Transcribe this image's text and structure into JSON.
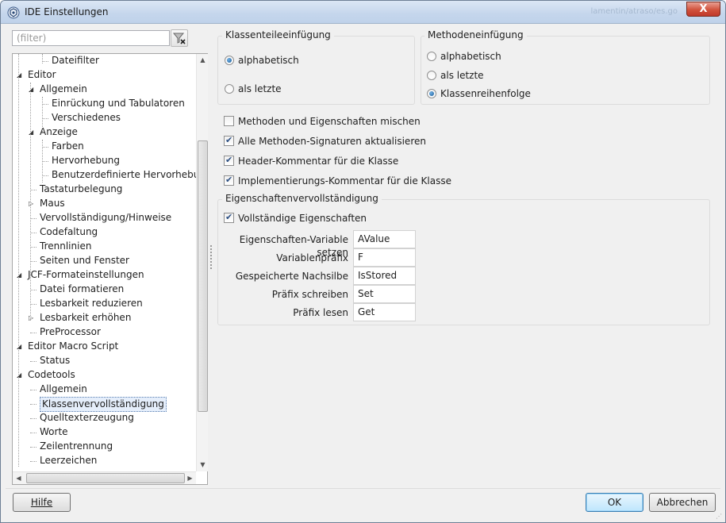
{
  "window": {
    "title": "IDE Einstellungen",
    "close_glyph": "X",
    "ghost_title": "lamentin/atraso/es.go"
  },
  "filter": {
    "placeholder": "(filter)"
  },
  "tree": {
    "items": [
      {
        "label": "Dateifilter",
        "level": 2
      },
      {
        "label": "Editor",
        "level": 0,
        "expanded": true
      },
      {
        "label": "Allgemein",
        "level": 1,
        "expanded": true
      },
      {
        "label": "Einrückung und Tabulatoren",
        "level": 2
      },
      {
        "label": "Verschiedenes",
        "level": 2
      },
      {
        "label": "Anzeige",
        "level": 1,
        "expanded": true
      },
      {
        "label": "Farben",
        "level": 2
      },
      {
        "label": "Hervorhebung",
        "level": 2
      },
      {
        "label": "Benutzerdefinierte Hervorhebung",
        "level": 2
      },
      {
        "label": "Tastaturbelegung",
        "level": 1
      },
      {
        "label": "Maus",
        "level": 1,
        "collapsed": true
      },
      {
        "label": "Vervollständigung/Hinweise",
        "level": 1
      },
      {
        "label": "Codefaltung",
        "level": 1
      },
      {
        "label": "Trennlinien",
        "level": 1
      },
      {
        "label": "Seiten und Fenster",
        "level": 1
      },
      {
        "label": "JCF-Formateinstellungen",
        "level": 0,
        "expanded": true
      },
      {
        "label": "Datei formatieren",
        "level": 1
      },
      {
        "label": "Lesbarkeit reduzieren",
        "level": 1
      },
      {
        "label": "Lesbarkeit erhöhen",
        "level": 1,
        "collapsed": true
      },
      {
        "label": "PreProcessor",
        "level": 1
      },
      {
        "label": "Editor Macro Script",
        "level": 0,
        "expanded": true
      },
      {
        "label": "Status",
        "level": 1
      },
      {
        "label": "Codetools",
        "level": 0,
        "expanded": true
      },
      {
        "label": "Allgemein",
        "level": 1
      },
      {
        "label": "Klassenvervollständigung",
        "level": 1,
        "selected": true
      },
      {
        "label": "Quelltexterzeugung",
        "level": 1
      },
      {
        "label": "Worte",
        "level": 1
      },
      {
        "label": "Zeilentrennung",
        "level": 1
      },
      {
        "label": "Leerzeichen",
        "level": 1
      }
    ]
  },
  "class_insertion": {
    "title": "Klassenteileeinfügung",
    "options": [
      {
        "label": "alphabetisch",
        "checked": true
      },
      {
        "label": "als letzte",
        "checked": false
      }
    ]
  },
  "method_insertion": {
    "title": "Methodeneinfügung",
    "options": [
      {
        "label": "alphabetisch",
        "checked": false
      },
      {
        "label": "als letzte",
        "checked": false
      },
      {
        "label": "Klassenreihenfolge",
        "checked": true
      }
    ]
  },
  "checkboxes": [
    {
      "label": "Methoden und Eigenschaften mischen",
      "checked": false
    },
    {
      "label": "Alle Methoden-Signaturen aktualisieren",
      "checked": true
    },
    {
      "label": "Header-Kommentar für die Klasse",
      "checked": true
    },
    {
      "label": "Implementierungs-Kommentar für die Klasse",
      "checked": true
    }
  ],
  "property_completion": {
    "title": "Eigenschaftenvervollständigung",
    "full_properties": {
      "label": "Vollständige Eigenschaften",
      "checked": true
    },
    "fields": [
      {
        "label": "Eigenschaften-Variable setzen",
        "value": "AValue"
      },
      {
        "label": "Variablenpräfix",
        "value": "F"
      },
      {
        "label": "Gespeicherte Nachsilbe",
        "value": "IsStored"
      },
      {
        "label": "Präfix schreiben",
        "value": "Set"
      },
      {
        "label": "Präfix lesen",
        "value": "Get"
      }
    ]
  },
  "footer": {
    "help_label": "Hilfe",
    "ok_label": "OK",
    "cancel_label": "Abbrechen"
  },
  "colors": {
    "titlebar": "#c5d6ec",
    "close": "#c0392b",
    "selection": "#e5eefb",
    "radio_checked": "#1d5d97"
  }
}
